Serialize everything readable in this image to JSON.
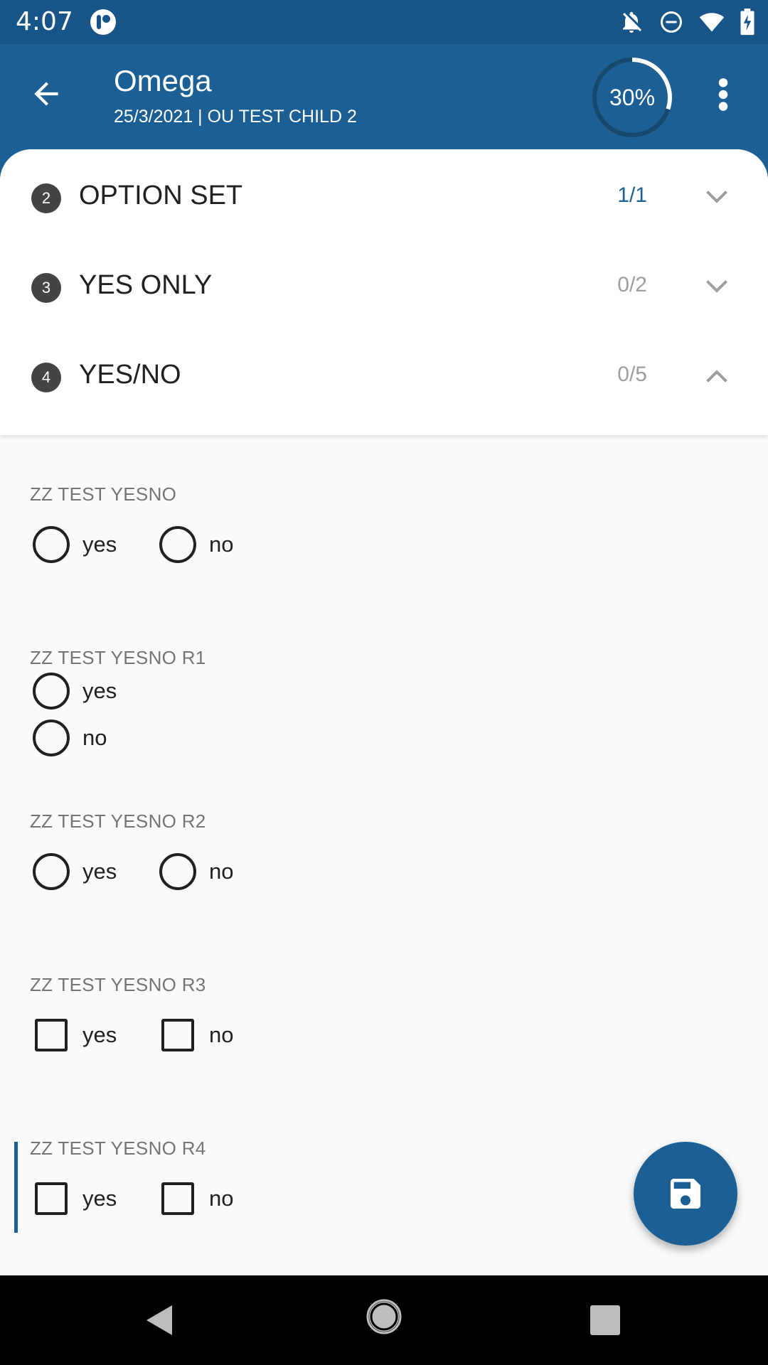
{
  "status_bar": {
    "time": "4:07",
    "icons": [
      "notifications-off-icon",
      "do-not-disturb-icon",
      "wifi-icon",
      "battery-charging-icon"
    ]
  },
  "app_bar": {
    "title": "Omega",
    "subtitle": "25/3/2021 | OU TEST CHILD 2",
    "progress_label": "30%",
    "progress_value": 0.3
  },
  "sections": [
    {
      "number": "2",
      "title": "OPTION SET",
      "count": "1/1",
      "expanded": false
    },
    {
      "number": "3",
      "title": "YES ONLY",
      "count": "0/2",
      "expanded": false
    },
    {
      "number": "4",
      "title": "YES/NO",
      "count": "0/5",
      "expanded": true
    }
  ],
  "fields": [
    {
      "label": "ZZ TEST YESNO",
      "control": "radio",
      "layout": "horizontal",
      "options": [
        "yes",
        "no"
      ]
    },
    {
      "label": "ZZ TEST YESNO R1",
      "control": "radio",
      "layout": "vertical",
      "options": [
        "yes",
        "no"
      ]
    },
    {
      "label": "ZZ TEST YESNO R2",
      "control": "radio",
      "layout": "horizontal",
      "options": [
        "yes",
        "no"
      ]
    },
    {
      "label": "ZZ TEST YESNO R3",
      "control": "checkbox",
      "layout": "horizontal",
      "options": [
        "yes",
        "no"
      ]
    },
    {
      "label": "ZZ TEST YESNO R4",
      "control": "checkbox",
      "layout": "horizontal",
      "options": [
        "yes",
        "no"
      ]
    }
  ],
  "fab": {
    "icon": "save-icon"
  },
  "colors": {
    "primary": "#1b5f95",
    "status_bar": "#175588",
    "text": "#212121",
    "muted": "#9e9e9e"
  }
}
